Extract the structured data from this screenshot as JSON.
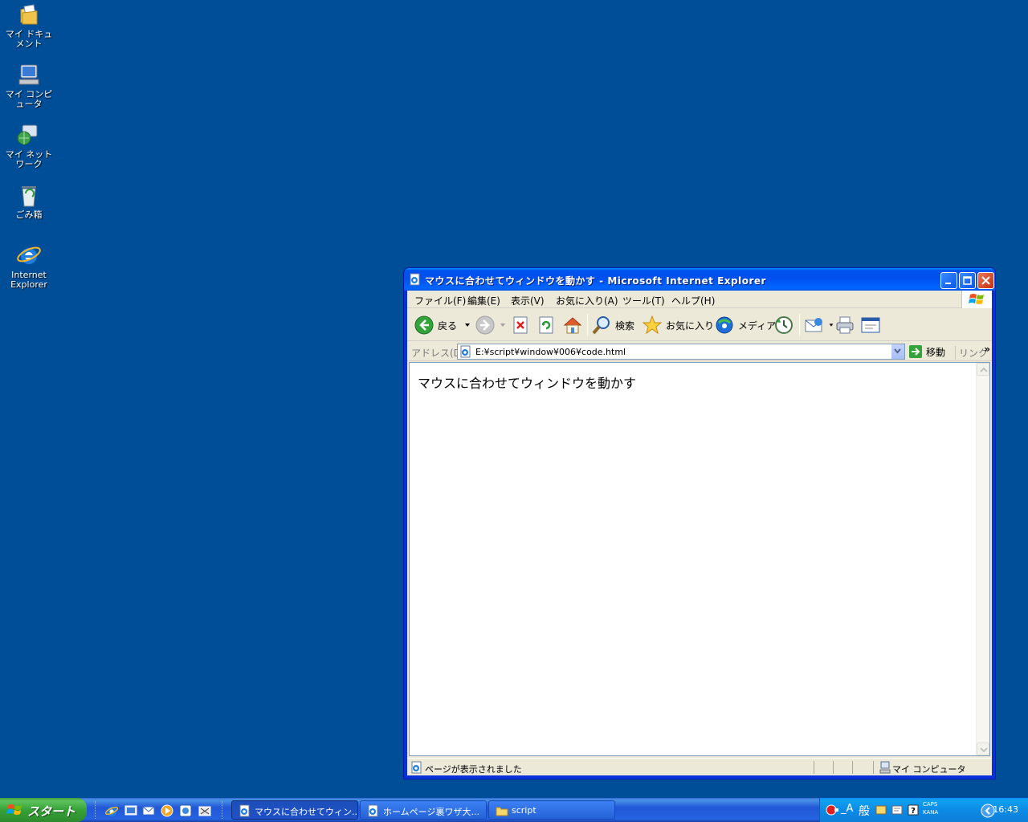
{
  "desktop": {
    "icons": [
      {
        "label": "マイ ドキュメント"
      },
      {
        "label": "マイ コンピュータ"
      },
      {
        "label": "マイ ネットワーク"
      },
      {
        "label": "ごみ箱"
      },
      {
        "label": "Internet Explorer"
      }
    ]
  },
  "window": {
    "title": "マウスに合わせてウィンドウを動かす - Microsoft Internet Explorer",
    "menu": [
      "ファイル(F)",
      "編集(E)",
      "表示(V)",
      "お気に入り(A)",
      "ツール(T)",
      "ヘルプ(H)"
    ],
    "toolbar": {
      "back": "戻る",
      "search": "検索",
      "favorites": "お気に入り",
      "media": "メディア"
    },
    "address": {
      "label": "アドレス(D)",
      "url": "E:¥script¥window¥006¥code.html",
      "go": "移動",
      "links": "リンク",
      "more": "»"
    },
    "content": {
      "text": "マウスに合わせてウィンドウを動かす"
    },
    "status": {
      "text": "ページが表示されました",
      "zone": "マイ コンピュータ"
    }
  },
  "taskbar": {
    "start": "スタート",
    "tasks": [
      {
        "label": "マウスに合わせてウィン..."
      },
      {
        "label": "ホームページ裏ワザ大..."
      },
      {
        "label": "script"
      }
    ],
    "tray": {
      "ime": "般",
      "caps": "CAPS",
      "kana": "KANA",
      "clock": "16:43"
    }
  },
  "colors": {
    "desktop": "#004e98",
    "titlebar": "#0053ee",
    "taskbar": "#2157d7",
    "start": "#37a137"
  }
}
